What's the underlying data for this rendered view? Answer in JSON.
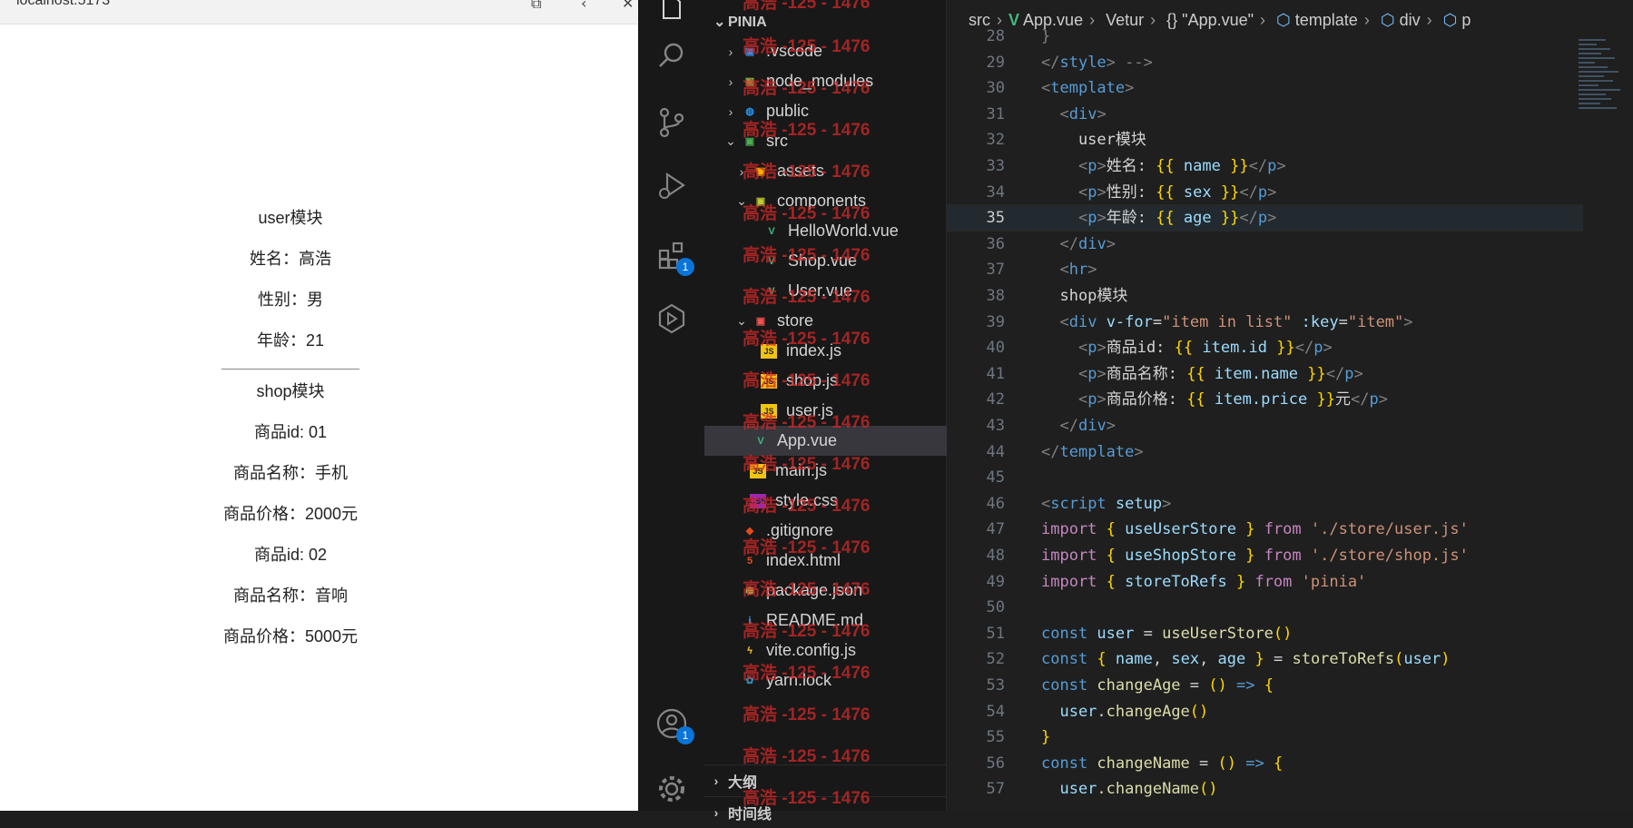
{
  "browser": {
    "url_fragment": "localhost:5173",
    "user_module": {
      "title": "user模块",
      "name": "姓名：高浩",
      "sex": "性别：男",
      "age": "年龄：21"
    },
    "shop_module": {
      "title": "shop模块",
      "items": [
        {
          "id": "商品id: 01",
          "name": "商品名称：手机",
          "price": "商品价格：2000元"
        },
        {
          "id": "商品id: 02",
          "name": "商品名称：音响",
          "price": "商品价格：5000元"
        }
      ]
    }
  },
  "activity_bar": {
    "icons": [
      "explorer-icon",
      "search-icon",
      "source-control-icon",
      "run-debug-icon",
      "extensions-icon",
      "remote-explorer-icon",
      "account-icon",
      "settings-gear-icon"
    ],
    "extensions_badge": "1",
    "account_badge": "1"
  },
  "explorer": {
    "root": "PINIA",
    "items": [
      {
        "label": ".vscode",
        "chev": "›",
        "icon": "vscode-folder-icon"
      },
      {
        "label": "node_modules",
        "chev": "›",
        "icon": "node-modules-folder-icon"
      },
      {
        "label": "public",
        "chev": "›",
        "icon": "public-folder-icon"
      },
      {
        "label": "src",
        "chev": "⌄",
        "icon": "src-folder-icon"
      },
      {
        "label": "assets",
        "chev": "›",
        "icon": "assets-folder-icon"
      },
      {
        "label": "components",
        "chev": "⌄",
        "icon": "components-folder-icon"
      },
      {
        "label": "HelloWorld.vue",
        "chev": "",
        "icon": "vue-file-icon"
      },
      {
        "label": "Shop.vue",
        "chev": "",
        "icon": "vue-file-icon"
      },
      {
        "label": "User.vue",
        "chev": "",
        "icon": "vue-file-icon"
      },
      {
        "label": "store",
        "chev": "⌄",
        "icon": "store-folder-icon"
      },
      {
        "label": "index.js",
        "chev": "",
        "icon": "js-file-icon"
      },
      {
        "label": "shop.js",
        "chev": "",
        "icon": "js-file-icon"
      },
      {
        "label": "user.js",
        "chev": "",
        "icon": "js-file-icon"
      },
      {
        "label": "App.vue",
        "chev": "",
        "icon": "vue-file-icon"
      },
      {
        "label": "main.js",
        "chev": "",
        "icon": "js-file-icon"
      },
      {
        "label": "style.css",
        "chev": "",
        "icon": "css-file-icon"
      },
      {
        "label": ".gitignore",
        "chev": "",
        "icon": "git-file-icon"
      },
      {
        "label": "index.html",
        "chev": "",
        "icon": "html-file-icon"
      },
      {
        "label": "package.json",
        "chev": "",
        "icon": "node-package-icon"
      },
      {
        "label": "README.md",
        "chev": "",
        "icon": "info-file-icon"
      },
      {
        "label": "vite.config.js",
        "chev": "",
        "icon": "vite-file-icon"
      },
      {
        "label": "yarn.lock",
        "chev": "",
        "icon": "yarn-file-icon"
      }
    ],
    "outline_label": "大纲",
    "timeline_label": "时间线",
    "watermark": "高浩 -125 - 1476"
  },
  "editor": {
    "breadcrumb": [
      "src",
      "App.vue",
      "Vetur",
      "{} \"App.vue\"",
      "template",
      "div",
      "p"
    ],
    "current_line": 35,
    "lines": [
      {
        "n": 28,
        "code": [
          {
            "c": "t-br",
            "t": "}"
          }
        ]
      },
      {
        "n": 29,
        "code": [
          {
            "c": "t-br",
            "t": "</"
          },
          {
            "c": "t-tag",
            "t": "style"
          },
          {
            "c": "t-br",
            "t": "> -->"
          }
        ]
      },
      {
        "n": 30,
        "code": [
          {
            "c": "t-br",
            "t": "<"
          },
          {
            "c": "t-tag",
            "t": "template"
          },
          {
            "c": "t-br",
            "t": ">"
          }
        ]
      },
      {
        "n": 31,
        "code": [
          {
            "c": "t-txt",
            "t": "  "
          },
          {
            "c": "t-br",
            "t": "<"
          },
          {
            "c": "t-tag",
            "t": "div"
          },
          {
            "c": "t-br",
            "t": ">"
          }
        ]
      },
      {
        "n": 32,
        "code": [
          {
            "c": "t-txt",
            "t": "    user模块"
          }
        ]
      },
      {
        "n": 33,
        "code": [
          {
            "c": "t-txt",
            "t": "    "
          },
          {
            "c": "t-br",
            "t": "<"
          },
          {
            "c": "t-tag",
            "t": "p"
          },
          {
            "c": "t-br",
            "t": ">"
          },
          {
            "c": "t-txt",
            "t": "姓名: "
          },
          {
            "c": "t-mus",
            "t": "{{"
          },
          {
            "c": "t-var",
            "t": " name "
          },
          {
            "c": "t-mus",
            "t": "}}"
          },
          {
            "c": "t-br",
            "t": "</"
          },
          {
            "c": "t-tag",
            "t": "p"
          },
          {
            "c": "t-br",
            "t": ">"
          }
        ]
      },
      {
        "n": 34,
        "code": [
          {
            "c": "t-txt",
            "t": "    "
          },
          {
            "c": "t-br",
            "t": "<"
          },
          {
            "c": "t-tag",
            "t": "p"
          },
          {
            "c": "t-br",
            "t": ">"
          },
          {
            "c": "t-txt",
            "t": "性别: "
          },
          {
            "c": "t-mus",
            "t": "{{"
          },
          {
            "c": "t-var",
            "t": " sex "
          },
          {
            "c": "t-mus",
            "t": "}}"
          },
          {
            "c": "t-br",
            "t": "</"
          },
          {
            "c": "t-tag",
            "t": "p"
          },
          {
            "c": "t-br",
            "t": ">"
          }
        ]
      },
      {
        "n": 35,
        "code": [
          {
            "c": "t-txt",
            "t": "    "
          },
          {
            "c": "t-br",
            "t": "<"
          },
          {
            "c": "t-tag",
            "t": "p"
          },
          {
            "c": "t-br",
            "t": ">"
          },
          {
            "c": "t-txt",
            "t": "年龄: "
          },
          {
            "c": "t-mus",
            "t": "{{"
          },
          {
            "c": "t-var",
            "t": " age "
          },
          {
            "c": "t-mus",
            "t": "}}"
          },
          {
            "c": "t-br",
            "t": "</"
          },
          {
            "c": "t-tag",
            "t": "p"
          },
          {
            "c": "t-br",
            "t": ">"
          }
        ]
      },
      {
        "n": 36,
        "code": [
          {
            "c": "t-txt",
            "t": "  "
          },
          {
            "c": "t-br",
            "t": "</"
          },
          {
            "c": "t-tag",
            "t": "div"
          },
          {
            "c": "t-br",
            "t": ">"
          }
        ]
      },
      {
        "n": 37,
        "code": [
          {
            "c": "t-txt",
            "t": "  "
          },
          {
            "c": "t-br",
            "t": "<"
          },
          {
            "c": "t-tag",
            "t": "hr"
          },
          {
            "c": "t-br",
            "t": ">"
          }
        ]
      },
      {
        "n": 38,
        "code": [
          {
            "c": "t-txt",
            "t": "  shop模块"
          }
        ]
      },
      {
        "n": 39,
        "code": [
          {
            "c": "t-txt",
            "t": "  "
          },
          {
            "c": "t-br",
            "t": "<"
          },
          {
            "c": "t-tag",
            "t": "div"
          },
          {
            "c": "t-attr",
            "t": " v-for"
          },
          {
            "c": "t-txt",
            "t": "="
          },
          {
            "c": "t-str",
            "t": "\"item in list\""
          },
          {
            "c": "t-attr",
            "t": " :key"
          },
          {
            "c": "t-txt",
            "t": "="
          },
          {
            "c": "t-str",
            "t": "\"item\""
          },
          {
            "c": "t-br",
            "t": ">"
          }
        ]
      },
      {
        "n": 40,
        "code": [
          {
            "c": "t-txt",
            "t": "    "
          },
          {
            "c": "t-br",
            "t": "<"
          },
          {
            "c": "t-tag",
            "t": "p"
          },
          {
            "c": "t-br",
            "t": ">"
          },
          {
            "c": "t-txt",
            "t": "商品id: "
          },
          {
            "c": "t-mus",
            "t": "{{"
          },
          {
            "c": "t-var",
            "t": " item.id "
          },
          {
            "c": "t-mus",
            "t": "}}"
          },
          {
            "c": "t-br",
            "t": "</"
          },
          {
            "c": "t-tag",
            "t": "p"
          },
          {
            "c": "t-br",
            "t": ">"
          }
        ]
      },
      {
        "n": 41,
        "code": [
          {
            "c": "t-txt",
            "t": "    "
          },
          {
            "c": "t-br",
            "t": "<"
          },
          {
            "c": "t-tag",
            "t": "p"
          },
          {
            "c": "t-br",
            "t": ">"
          },
          {
            "c": "t-txt",
            "t": "商品名称: "
          },
          {
            "c": "t-mus",
            "t": "{{"
          },
          {
            "c": "t-var",
            "t": " item.name "
          },
          {
            "c": "t-mus",
            "t": "}}"
          },
          {
            "c": "t-br",
            "t": "</"
          },
          {
            "c": "t-tag",
            "t": "p"
          },
          {
            "c": "t-br",
            "t": ">"
          }
        ]
      },
      {
        "n": 42,
        "code": [
          {
            "c": "t-txt",
            "t": "    "
          },
          {
            "c": "t-br",
            "t": "<"
          },
          {
            "c": "t-tag",
            "t": "p"
          },
          {
            "c": "t-br",
            "t": ">"
          },
          {
            "c": "t-txt",
            "t": "商品价格: "
          },
          {
            "c": "t-mus",
            "t": "{{"
          },
          {
            "c": "t-var",
            "t": " item.price "
          },
          {
            "c": "t-mus",
            "t": "}}"
          },
          {
            "c": "t-txt",
            "t": "元"
          },
          {
            "c": "t-br",
            "t": "</"
          },
          {
            "c": "t-tag",
            "t": "p"
          },
          {
            "c": "t-br",
            "t": ">"
          }
        ]
      },
      {
        "n": 43,
        "code": [
          {
            "c": "t-txt",
            "t": "  "
          },
          {
            "c": "t-br",
            "t": "</"
          },
          {
            "c": "t-tag",
            "t": "div"
          },
          {
            "c": "t-br",
            "t": ">"
          }
        ]
      },
      {
        "n": 44,
        "code": [
          {
            "c": "t-br",
            "t": "</"
          },
          {
            "c": "t-tag",
            "t": "template"
          },
          {
            "c": "t-br",
            "t": ">"
          }
        ]
      },
      {
        "n": 45,
        "code": []
      },
      {
        "n": 46,
        "code": [
          {
            "c": "t-br",
            "t": "<"
          },
          {
            "c": "t-tag",
            "t": "script"
          },
          {
            "c": "t-attr",
            "t": " setup"
          },
          {
            "c": "t-br",
            "t": ">"
          }
        ]
      },
      {
        "n": 47,
        "code": [
          {
            "c": "t-imp",
            "t": "import"
          },
          {
            "c": "t-mus",
            "t": " {"
          },
          {
            "c": "t-var",
            "t": " useUserStore "
          },
          {
            "c": "t-mus",
            "t": "}"
          },
          {
            "c": "t-imp",
            "t": " from"
          },
          {
            "c": "t-str",
            "t": " './store/user.js'"
          }
        ]
      },
      {
        "n": 48,
        "code": [
          {
            "c": "t-imp",
            "t": "import"
          },
          {
            "c": "t-mus",
            "t": " {"
          },
          {
            "c": "t-var",
            "t": " useShopStore "
          },
          {
            "c": "t-mus",
            "t": "}"
          },
          {
            "c": "t-imp",
            "t": " from"
          },
          {
            "c": "t-str",
            "t": " './store/shop.js'"
          }
        ]
      },
      {
        "n": 49,
        "code": [
          {
            "c": "t-imp",
            "t": "import"
          },
          {
            "c": "t-mus",
            "t": " {"
          },
          {
            "c": "t-var",
            "t": " storeToRefs "
          },
          {
            "c": "t-mus",
            "t": "}"
          },
          {
            "c": "t-imp",
            "t": " from"
          },
          {
            "c": "t-str",
            "t": " 'pinia'"
          }
        ]
      },
      {
        "n": 50,
        "code": []
      },
      {
        "n": 51,
        "code": [
          {
            "c": "t-kw",
            "t": "const"
          },
          {
            "c": "t-var",
            "t": " user"
          },
          {
            "c": "t-txt",
            "t": " = "
          },
          {
            "c": "t-fn",
            "t": "useUserStore"
          },
          {
            "c": "t-mus",
            "t": "()"
          }
        ]
      },
      {
        "n": 52,
        "code": [
          {
            "c": "t-kw",
            "t": "const"
          },
          {
            "c": "t-mus",
            "t": " {"
          },
          {
            "c": "t-var",
            "t": " name"
          },
          {
            "c": "t-txt",
            "t": ","
          },
          {
            "c": "t-var",
            "t": " sex"
          },
          {
            "c": "t-txt",
            "t": ","
          },
          {
            "c": "t-var",
            "t": " age "
          },
          {
            "c": "t-mus",
            "t": "}"
          },
          {
            "c": "t-txt",
            "t": " = "
          },
          {
            "c": "t-fn",
            "t": "storeToRefs"
          },
          {
            "c": "t-mus",
            "t": "("
          },
          {
            "c": "t-var",
            "t": "user"
          },
          {
            "c": "t-mus",
            "t": ")"
          }
        ]
      },
      {
        "n": 53,
        "code": [
          {
            "c": "t-kw",
            "t": "const"
          },
          {
            "c": "t-fn",
            "t": " changeAge"
          },
          {
            "c": "t-txt",
            "t": " = "
          },
          {
            "c": "t-mus",
            "t": "()"
          },
          {
            "c": "t-kw",
            "t": " =>"
          },
          {
            "c": "t-mus",
            "t": " {"
          }
        ]
      },
      {
        "n": 54,
        "code": [
          {
            "c": "t-var",
            "t": "  user"
          },
          {
            "c": "t-txt",
            "t": "."
          },
          {
            "c": "t-fn",
            "t": "changeAge"
          },
          {
            "c": "t-mus",
            "t": "()"
          }
        ]
      },
      {
        "n": 55,
        "code": [
          {
            "c": "t-mus",
            "t": "}"
          }
        ]
      },
      {
        "n": 56,
        "code": [
          {
            "c": "t-kw",
            "t": "const"
          },
          {
            "c": "t-fn",
            "t": " changeName"
          },
          {
            "c": "t-txt",
            "t": " = "
          },
          {
            "c": "t-mus",
            "t": "()"
          },
          {
            "c": "t-kw",
            "t": " =>"
          },
          {
            "c": "t-mus",
            "t": " {"
          }
        ]
      },
      {
        "n": 57,
        "code": [
          {
            "c": "t-var",
            "t": "  user"
          },
          {
            "c": "t-txt",
            "t": "."
          },
          {
            "c": "t-fn",
            "t": "changeName"
          },
          {
            "c": "t-mus",
            "t": "()"
          }
        ]
      }
    ]
  },
  "colors": {
    "accent_badge": "#0a74d9",
    "vue_green": "#41b883",
    "watermark_red": "#d22828"
  }
}
